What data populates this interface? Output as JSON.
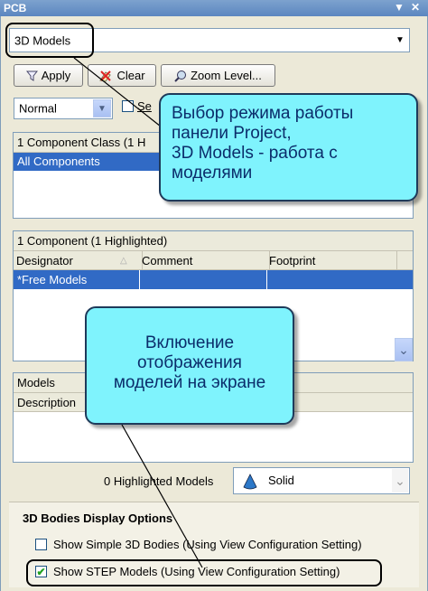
{
  "panel": {
    "title": "PCB",
    "pin_icon": "▼",
    "close_icon": "✕"
  },
  "mode_select": {
    "value": "3D Models"
  },
  "toolbar": {
    "apply": "Apply",
    "clear": "Clear",
    "zoom": "Zoom Level..."
  },
  "mask_select": {
    "value": "Normal",
    "select_partial": "Se"
  },
  "classes": {
    "header": "1 Component Class (1 H",
    "items": [
      "All Components"
    ]
  },
  "components": {
    "header": "1 Component (1 Highlighted)",
    "columns": [
      "Designator",
      "Comment",
      "Footprint"
    ],
    "rows": [
      {
        "designator": "*Free Models",
        "comment": "",
        "footprint": ""
      }
    ]
  },
  "models": {
    "header": "Models",
    "columns": [
      "Description"
    ],
    "highlighted_count": "0 Highlighted Models",
    "render_mode": "Solid"
  },
  "display_options": {
    "title": "3D Bodies Display Options",
    "show_simple": {
      "label": "Show Simple 3D Bodies (Using View Configuration Setting)",
      "checked": false
    },
    "show_step": {
      "label": "Show STEP Models (Using View Configuration Setting)",
      "checked": true
    }
  },
  "callouts": {
    "mode": "Выбор режима работы панели Project, 3D Models - работа с моделями",
    "mode_lines": [
      "Выбор режима работы",
      "панели Project,",
      "3D Models - работа с",
      "моделями"
    ],
    "display": "Включение отображения моделей на экране",
    "display_lines": [
      "Включение",
      "отображения",
      "моделей на экране"
    ]
  }
}
